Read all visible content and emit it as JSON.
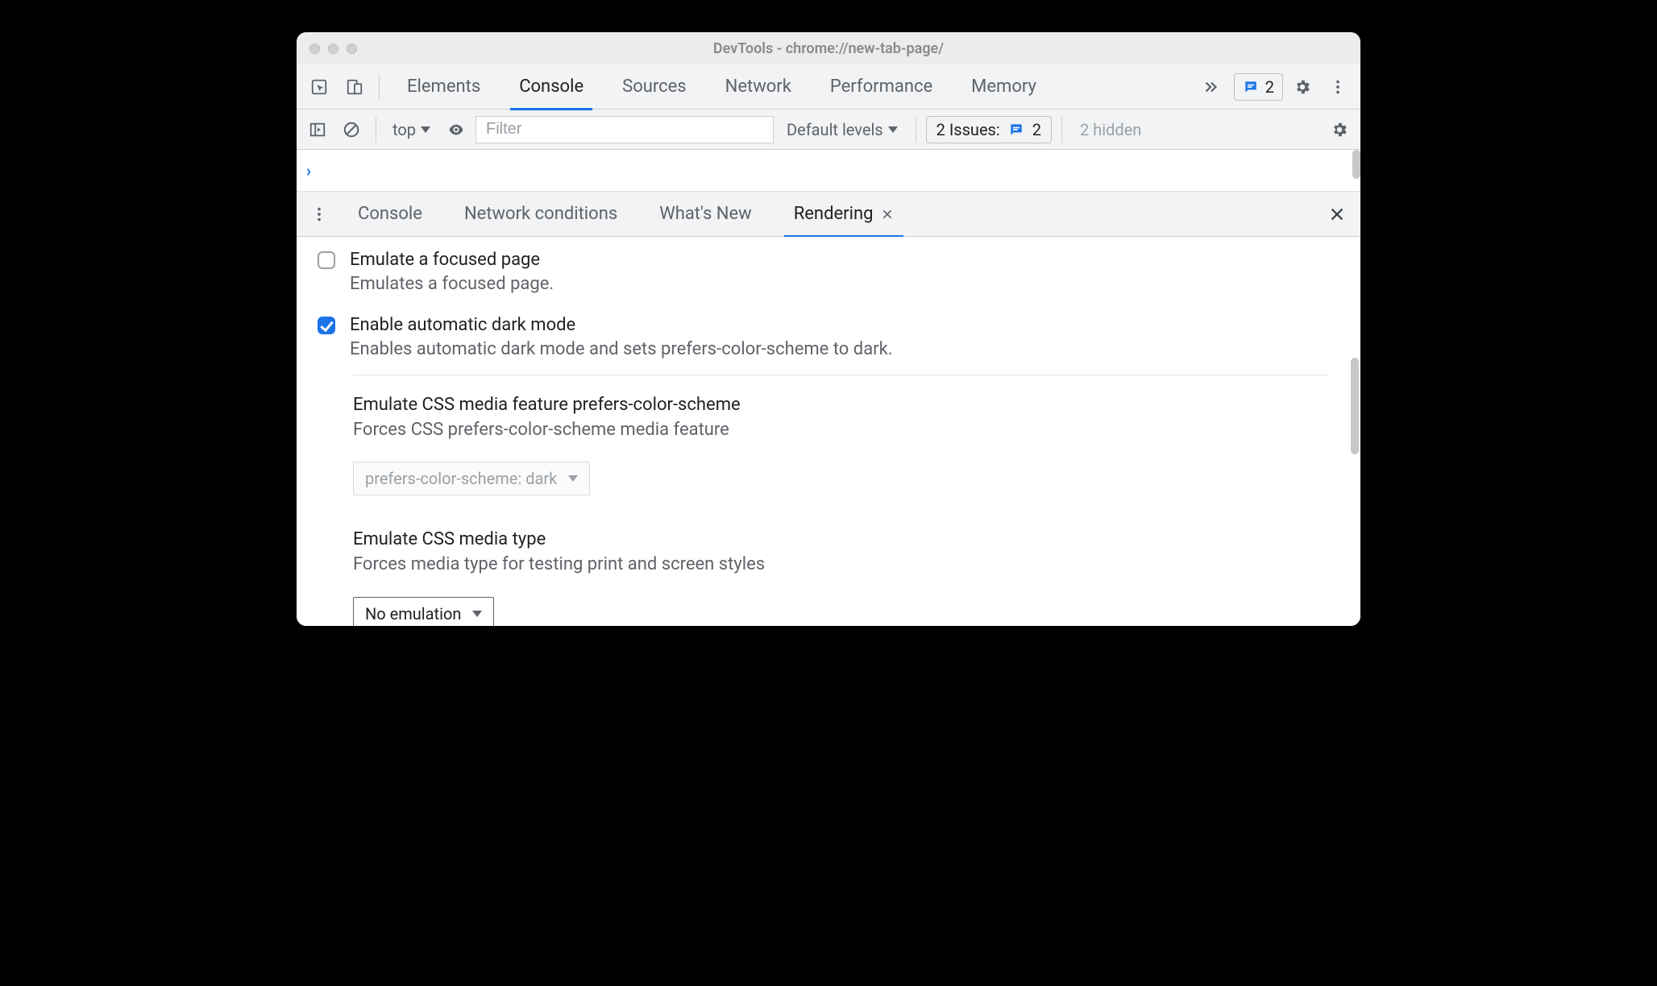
{
  "window": {
    "title": "DevTools - chrome://new-tab-page/"
  },
  "main_tabs": {
    "items": [
      "Elements",
      "Console",
      "Sources",
      "Network",
      "Performance",
      "Memory"
    ],
    "active_index": 1
  },
  "messages_badge": {
    "count": "2"
  },
  "console_toolbar": {
    "context": "top",
    "filter_placeholder": "Filter",
    "levels_label": "Default levels",
    "issues_label": "2 Issues:",
    "issues_count": "2",
    "hidden_label": "2 hidden"
  },
  "drawer_tabs": {
    "items": [
      "Console",
      "Network conditions",
      "What's New",
      "Rendering"
    ],
    "active_index": 3
  },
  "rendering": {
    "emulate_focused": {
      "title": "Emulate a focused page",
      "desc": "Emulates a focused page.",
      "checked": false
    },
    "auto_dark": {
      "title": "Enable automatic dark mode",
      "desc": "Enables automatic dark mode and sets prefers-color-scheme to dark.",
      "checked": true
    },
    "prefers_color_scheme": {
      "title": "Emulate CSS media feature prefers-color-scheme",
      "desc": "Forces CSS prefers-color-scheme media feature",
      "value": "prefers-color-scheme: dark"
    },
    "media_type": {
      "title": "Emulate CSS media type",
      "desc": "Forces media type for testing print and screen styles",
      "value": "No emulation"
    }
  }
}
